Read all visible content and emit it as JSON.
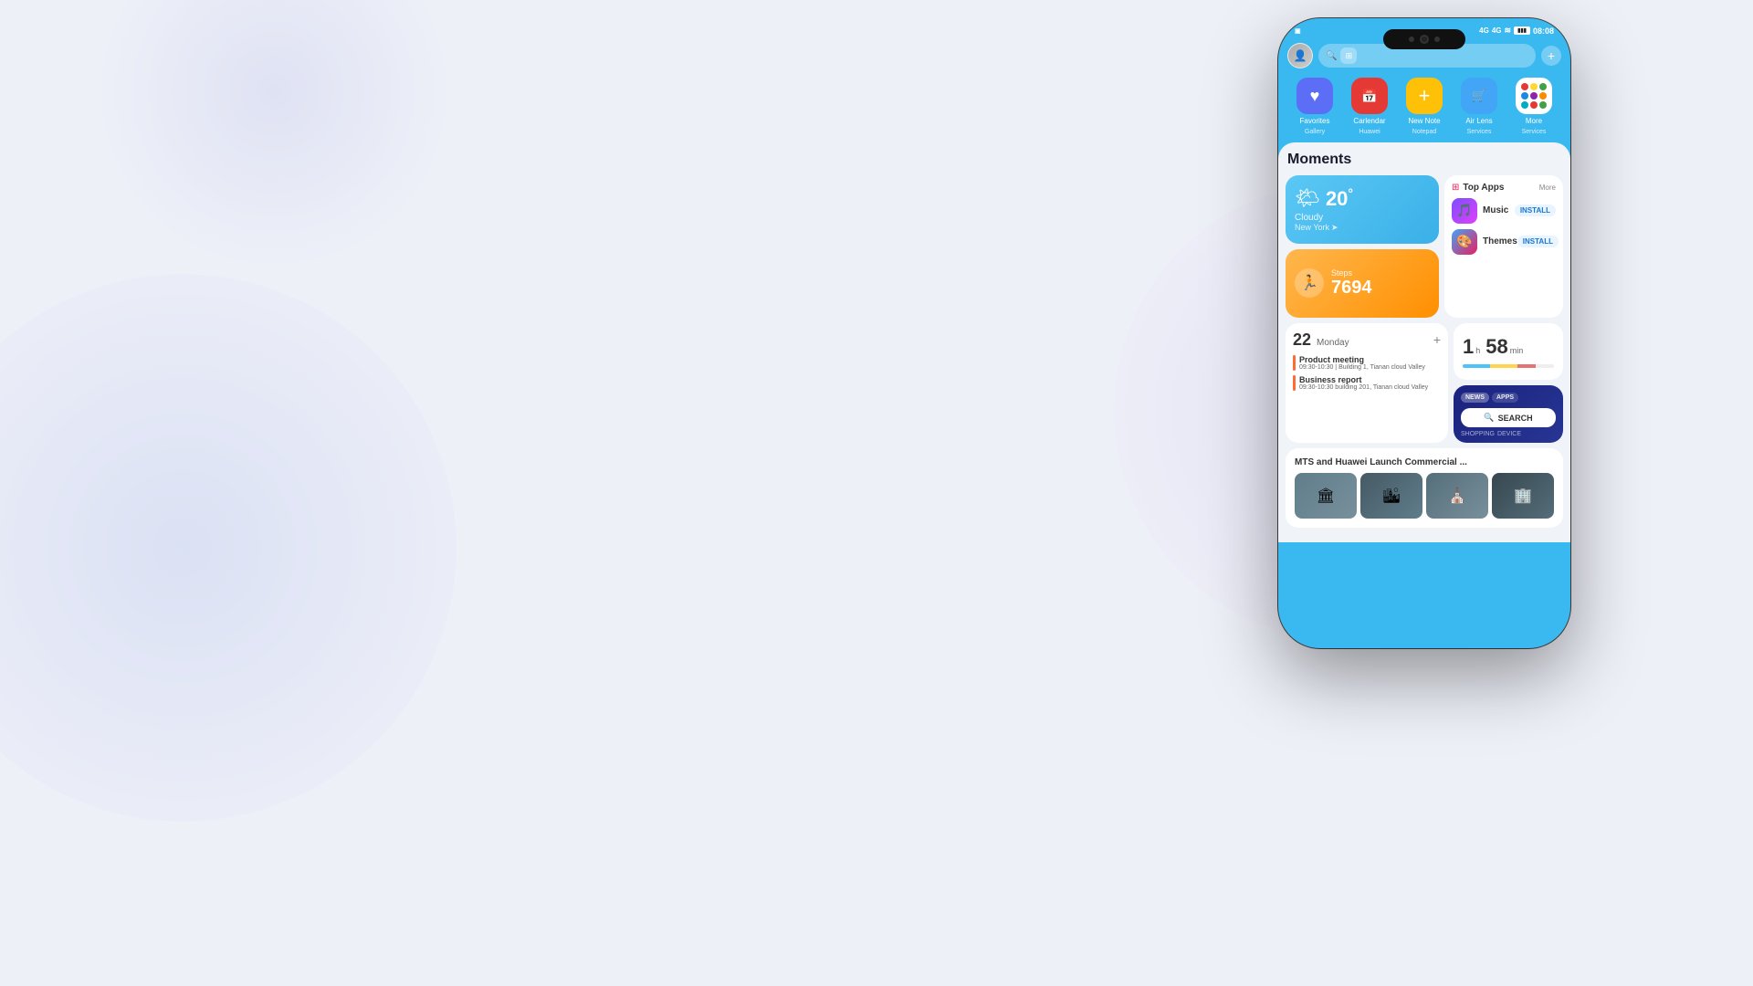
{
  "background": {
    "color": "#eef0f8"
  },
  "phone": {
    "status_bar": {
      "time": "08:08",
      "signal": "4G",
      "signal2": "4G",
      "wifi": true
    },
    "search_placeholder": "Search",
    "moments_title": "Moments",
    "apps": [
      {
        "id": "favorites",
        "label": "Favorites",
        "sublabel": "Gallery",
        "icon": "♥",
        "color": "#5b6ef5"
      },
      {
        "id": "calendar",
        "label": "Carlendar",
        "sublabel": "Huawei",
        "icon": "📅",
        "color": "#e53935"
      },
      {
        "id": "new-note",
        "label": "New Note",
        "sublabel": "Notepad",
        "icon": "+",
        "color": "#ffc107"
      },
      {
        "id": "air-lens",
        "label": "Air Lens",
        "sublabel": "Services",
        "icon": "🔲",
        "color": "#42a5f5"
      },
      {
        "id": "more",
        "label": "More",
        "sublabel": "Services",
        "icon": "⋯",
        "color": "white"
      }
    ],
    "weather": {
      "temperature": "20",
      "unit": "°",
      "condition": "Cloudy",
      "city": "New York"
    },
    "steps": {
      "label": "Steps",
      "count": "7694"
    },
    "top_apps": {
      "title": "Top Apps",
      "more_label": "More",
      "apps": [
        {
          "name": "Music",
          "action": "INSTALL"
        },
        {
          "name": "Themes",
          "action": "INSTALL"
        }
      ]
    },
    "calendar_widget": {
      "day_number": "22",
      "day_name": "Monday",
      "events": [
        {
          "title": "Product meeting",
          "time": "09:30-10:30 | Building 1, Tianan cloud Valley"
        },
        {
          "title": "Business report",
          "time": "09:30-10:30 building 201, Tianan cloud Valley"
        }
      ]
    },
    "timer": {
      "hours": "1",
      "h_label": "h",
      "mins": "58",
      "m_label": "min"
    },
    "search_widget": {
      "tags": [
        "NEWS",
        "APPS"
      ],
      "button_label": "🔍 SEARCH",
      "bottom_tags": [
        "SHOPPING",
        "DEVICE"
      ]
    },
    "news": {
      "headline": "MTS and Huawei Launch Commercial ..."
    }
  }
}
